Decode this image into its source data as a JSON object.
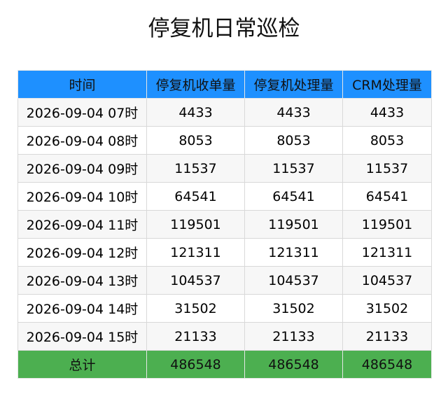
{
  "page": {
    "title": "停复机日常巡检"
  },
  "table": {
    "headers": [
      "时间",
      "停复机收单量",
      "停复机处理量",
      "CRM处理量"
    ],
    "rows": [
      [
        "2026-09-04 07时",
        "4433",
        "4433",
        "4433"
      ],
      [
        "2026-09-04 08时",
        "8053",
        "8053",
        "8053"
      ],
      [
        "2026-09-04 09时",
        "11537",
        "11537",
        "11537"
      ],
      [
        "2026-09-04 10时",
        "64541",
        "64541",
        "64541"
      ],
      [
        "2026-09-04 11时",
        "119501",
        "119501",
        "119501"
      ],
      [
        "2026-09-04 12时",
        "121311",
        "121311",
        "121311"
      ],
      [
        "2026-09-04 13时",
        "104537",
        "104537",
        "104537"
      ],
      [
        "2026-09-04 14时",
        "31502",
        "31502",
        "31502"
      ],
      [
        "2026-09-04 15时",
        "21133",
        "21133",
        "21133"
      ]
    ],
    "total": [
      "总计",
      "486548",
      "486548",
      "486548"
    ]
  },
  "colors": {
    "header_bg": "#1e90ff",
    "total_bg": "#4caf50",
    "row_alt_bg": "#f7f7f7"
  }
}
